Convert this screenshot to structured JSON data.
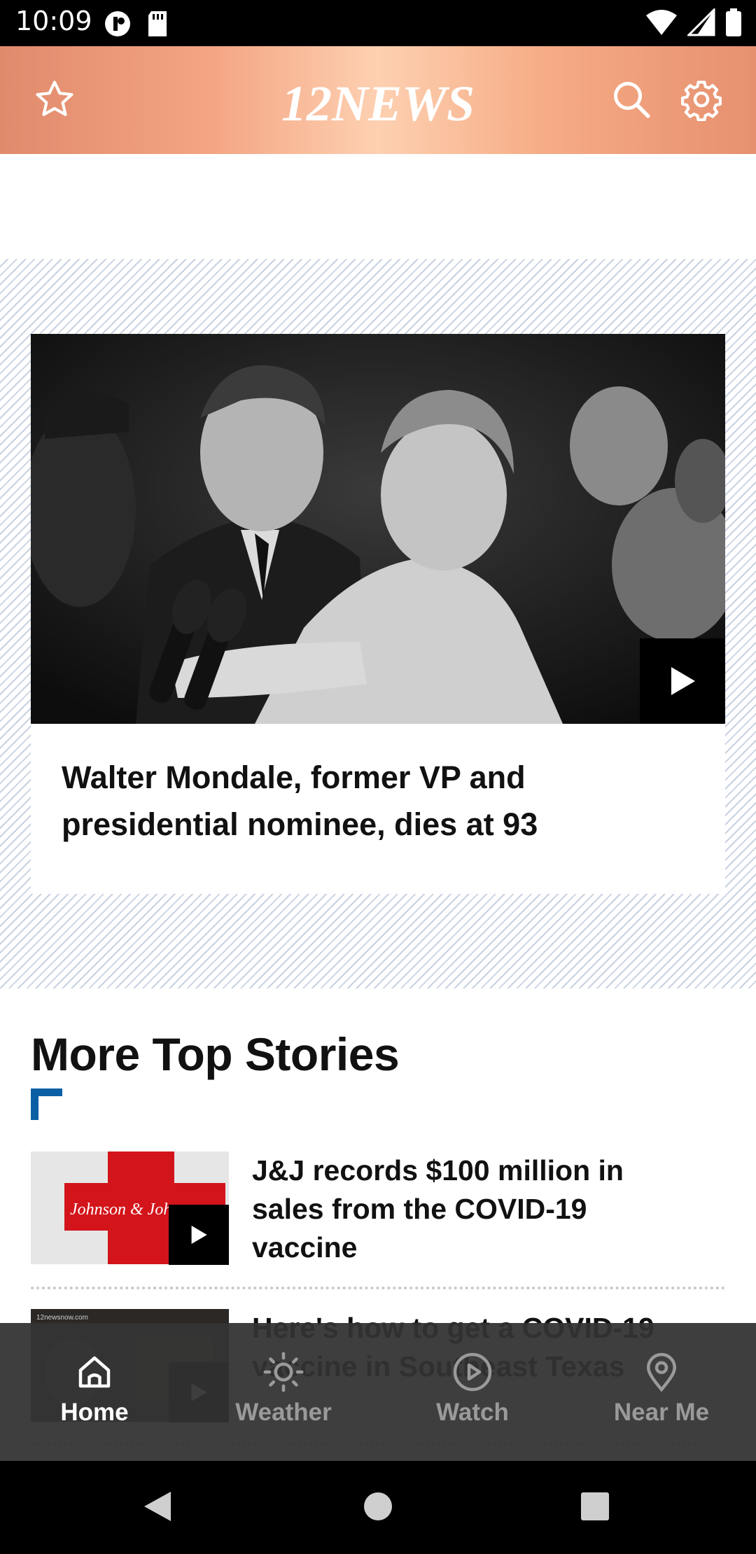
{
  "status_bar": {
    "time": "10:09"
  },
  "header": {
    "logo_text": "12NEWS"
  },
  "hero": {
    "title": "Walter Mondale, former VP and presidential nominee, dies at 93"
  },
  "more_top_stories": {
    "heading": "More Top Stories",
    "items": [
      {
        "title": "J&J records $100 million in sales from the COVID-19 vaccine",
        "thumb_text": "Johnson & Johnson"
      },
      {
        "title": "Here's how to get a COVID-19 vaccine in Southeast Texas",
        "thumb_text": "12newsnow.com"
      }
    ]
  },
  "bottom_nav": {
    "items": [
      {
        "label": "Home",
        "icon": "home-icon",
        "active": true
      },
      {
        "label": "Weather",
        "icon": "sun-icon",
        "active": false
      },
      {
        "label": "Watch",
        "icon": "play-circle-icon",
        "active": false
      },
      {
        "label": "Near Me",
        "icon": "location-pin-icon",
        "active": false
      }
    ]
  },
  "colors": {
    "accent": "#0b5fa5",
    "header_peach": "#f4a583",
    "nav_bg": "#323232"
  }
}
